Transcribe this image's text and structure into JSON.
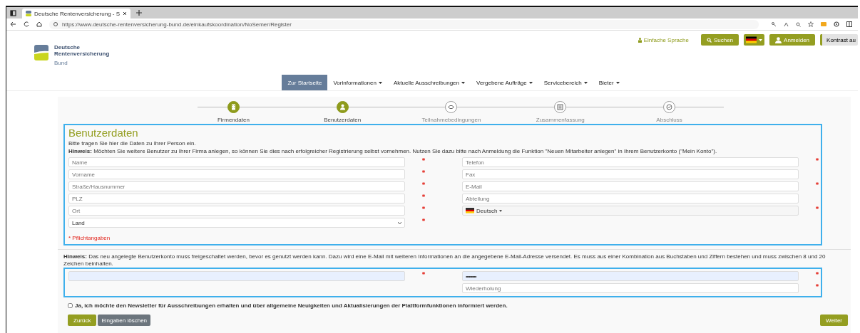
{
  "browser": {
    "tab_title": "Deutsche Rentenversicherung - S",
    "url": "https://www.deutsche-rentenversicherung-bund.de/einkaufskoordination/NoSemer/Register"
  },
  "header": {
    "logo_lines": [
      "Deutsche",
      "Rentenversicherung"
    ],
    "logo_sub": "Bund",
    "easy_language": "Einfache Sprache",
    "search_button": "Suchen",
    "login_button": "Anmelden",
    "contrast_button": "Kontrast au"
  },
  "nav": [
    {
      "label": "Zur Startseite",
      "selected": true,
      "dropdown": false
    },
    {
      "label": "Vorinformationen",
      "selected": false,
      "dropdown": true
    },
    {
      "label": "Aktuelle Ausschreibungen",
      "selected": false,
      "dropdown": true
    },
    {
      "label": "Vergebene Aufträge",
      "selected": false,
      "dropdown": true
    },
    {
      "label": "Servicebereich",
      "selected": false,
      "dropdown": true
    },
    {
      "label": "Bieter",
      "selected": false,
      "dropdown": true
    }
  ],
  "steps": [
    {
      "label": "Firmendaten",
      "completed": true
    },
    {
      "label": "Benutzerdaten",
      "completed": true
    },
    {
      "label": "Teilnahmebedingungen",
      "completed": false
    },
    {
      "label": "Zusammenfassung",
      "completed": false
    },
    {
      "label": "Abschluss",
      "completed": false
    }
  ],
  "form": {
    "title": "Benutzerdaten",
    "intro": "Bitte tragen Sie hier die Daten zu Ihrer Person ein.",
    "hint": "**Hinweis:** Möchten Sie weitere Benutzer zu Ihrer Firma anlegen, so können Sie dies nach erfolgreicher Registrierung selbst vornehmen. Nutzen Sie dazu bitte nach Anmeldung die Funktion \"Neuen Mitarbeiter anlegen\" in Ihrem Benutzerkonto (\"Mein Konto\").",
    "fields_left": [
      {
        "kind": "input",
        "placeholder": "Name",
        "required": true
      },
      {
        "kind": "input",
        "placeholder": "Vorname",
        "required": true
      },
      {
        "kind": "input",
        "placeholder": "Straße/Hausnummer",
        "required": true
      },
      {
        "kind": "input",
        "placeholder": "PLZ",
        "required": true
      },
      {
        "kind": "input",
        "placeholder": "Ort",
        "required": true
      },
      {
        "kind": "select",
        "value": "Land",
        "required": true
      }
    ],
    "fields_right": [
      {
        "kind": "input",
        "placeholder": "Telefon",
        "required": true
      },
      {
        "kind": "input",
        "placeholder": "Fax",
        "required": false
      },
      {
        "kind": "input",
        "placeholder": "E-Mail",
        "required": true
      },
      {
        "kind": "input",
        "placeholder": "Abteilung",
        "required": false
      },
      {
        "kind": "language",
        "value": "Deutsch",
        "required": true
      }
    ],
    "required_note": "* Pflichtangaben"
  },
  "account": {
    "hint": "**Hinweis:** Das neu angelegte Benutzerkonto muss freigeschaltet werden, bevor es genutzt werden kann. Dazu wird eine E-Mail mit weiteren Informationen an die angegebene E-Mail-Adresse versendet. Es muss aus einer Kombination aus Buchstaben und Ziffern bestehen und muss zwischen 8 und 20 Zeichen beinhalten.",
    "username": {
      "autofilled": true,
      "required": true
    },
    "password": {
      "value": "••••••••••",
      "autofilled": true,
      "required": true
    },
    "password_repeat": {
      "placeholder": "Wiederholung",
      "autofilled": false,
      "required": true
    }
  },
  "newsletter": {
    "label": "Ja, ich möchte den Newsletter für Ausschreibungen erhalten und über allgemeine Neuigkeiten und Aktualisierungen der Plattformfunktionen informiert werden.",
    "checked": false
  },
  "buttons": {
    "back": "Zurück",
    "reset": "Eingaben löschen",
    "next": "Weiter"
  }
}
